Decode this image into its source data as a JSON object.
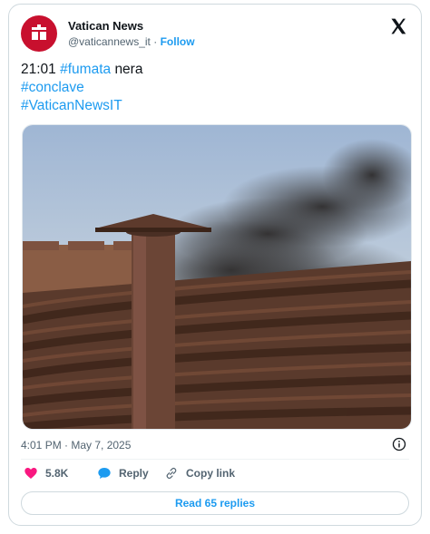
{
  "author": {
    "name": "Vatican News",
    "handle": "@vaticannews_it",
    "separator": "·",
    "follow_label": "Follow"
  },
  "tweet": {
    "time_text": "21:01",
    "hashtags": [
      "#fumata",
      "#conclave",
      "#VaticanNewsIT"
    ],
    "after_first": "nera"
  },
  "timestamp": "4:01 PM · May 7, 2025",
  "actions": {
    "likes": "5.8K",
    "reply_label": "Reply",
    "copy_label": "Copy link"
  },
  "read_replies_label": "Read 65 replies",
  "colors": {
    "brand_red": "#c8102e",
    "link_blue": "#1d9bf0",
    "like_pink": "#f91880",
    "text_dark": "#0f1419",
    "text_muted": "#536471"
  },
  "icons": {
    "platform": "x-logo-icon",
    "info": "info-icon",
    "like": "heart-icon",
    "reply": "speech-bubble-icon",
    "copy": "link-icon"
  }
}
